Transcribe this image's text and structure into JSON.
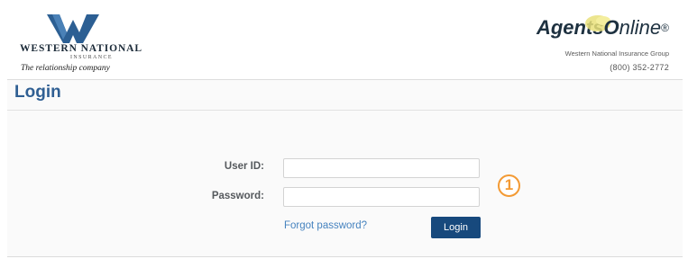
{
  "header": {
    "brand": {
      "name": "Western National",
      "subtitle": "Insurance",
      "tagline": "The relationship company",
      "logo_color": "#2c5f93"
    },
    "portal": {
      "logo_text_bold": "Agents",
      "logo_letter": "O",
      "logo_text_tail": "nline",
      "logo_registered": "®",
      "company_name": "Western National Insurance Group",
      "phone": "(800) 352-2772"
    }
  },
  "page": {
    "title": "Login"
  },
  "form": {
    "user_id_label": "User ID:",
    "user_id_value": "",
    "password_label": "Password:",
    "password_value": "",
    "forgot_link": "Forgot password?",
    "login_button": "Login"
  },
  "annotation": {
    "step_number": "1",
    "color": "#f39a34"
  },
  "colors": {
    "title": "#2f5f93",
    "button": "#17497d",
    "link": "#4683bf"
  }
}
